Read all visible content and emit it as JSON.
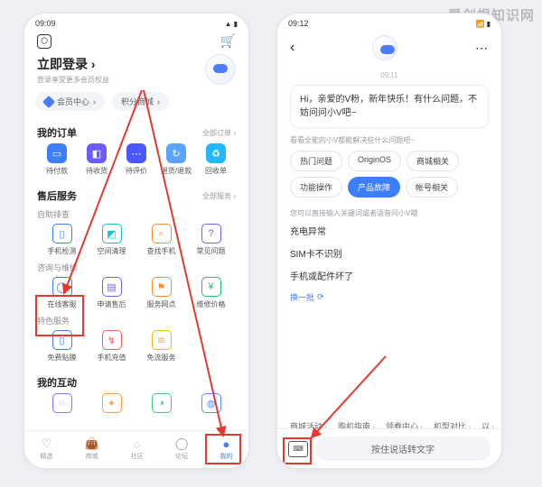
{
  "watermark": "爱创根知识网",
  "phone1": {
    "status_time": "09:09",
    "login_title": "立即登录",
    "login_sub": "登录享受更多会员权益",
    "chips": {
      "member": "会员中心",
      "points": "积分商城"
    },
    "orders": {
      "title": "我的订单",
      "more": "全部订单",
      "items": [
        "待付款",
        "待收货",
        "待评价",
        "退货/退款",
        "回收单"
      ]
    },
    "service": {
      "title": "售后服务",
      "more": "全部服务",
      "g1_title": "自助排查",
      "g1": [
        "手机检测",
        "空间清理",
        "查找手机",
        "常见问题"
      ],
      "g2_title": "咨询与维修",
      "g2": [
        "在线客服",
        "申请售后",
        "服务网点",
        "维修价格"
      ],
      "g3_title": "特色服务",
      "g3": [
        "免费贴膜",
        "手机充值",
        "免流服务"
      ]
    },
    "interact_title": "我的互动",
    "nav": [
      "精选",
      "商城",
      "社区",
      "论坛",
      "我的"
    ]
  },
  "phone2": {
    "status_time": "09:12",
    "ts": "09:11",
    "greeting": "Hi，亲爱的V粉，新年快乐！有什么问题，不妨问问小V吧~",
    "cap_hint": "看看全能的小V都能解决些什么问题吧~",
    "pills": [
      "热门问题",
      "OriginOS",
      "商城相关",
      "功能操作",
      "产品故障",
      "帐号相关"
    ],
    "pill_selected_index": 4,
    "input_hint": "您可以直接输入关键词或者语音问小V哦",
    "questions": [
      "充电异常",
      "SIM卡不识别",
      "手机或配件坏了"
    ],
    "refresh": "换一批",
    "links": [
      "商城活动",
      "购机指南",
      "领券中心",
      "机型对比",
      "以"
    ],
    "voice_placeholder": "按住说话转文字"
  }
}
